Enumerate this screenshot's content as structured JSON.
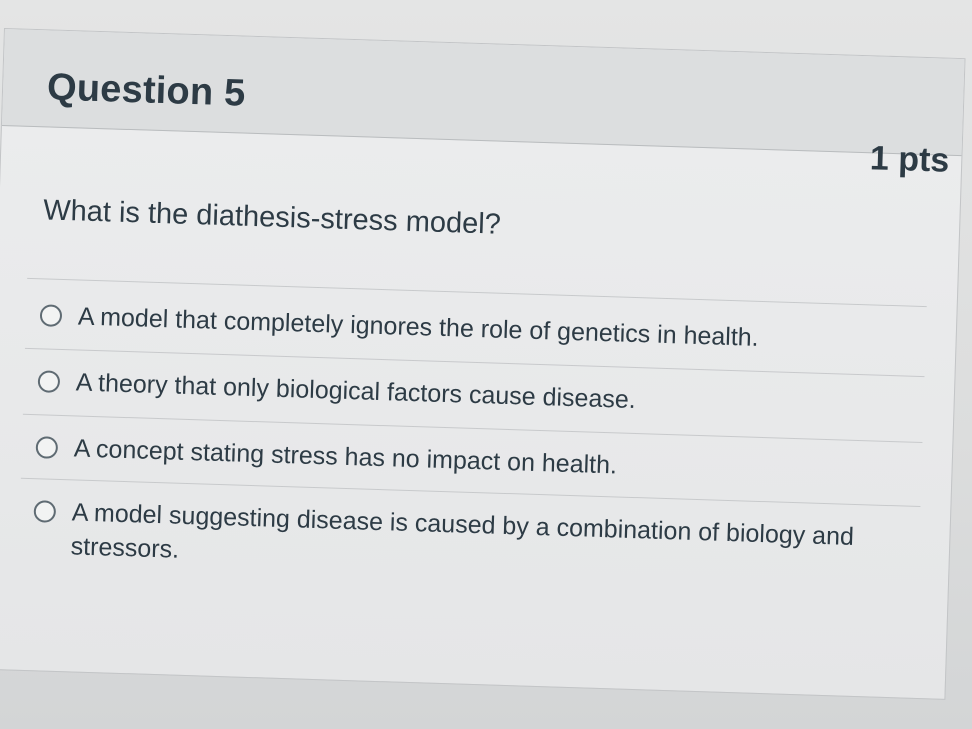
{
  "question": {
    "title": "Question 5",
    "points": "1 pts",
    "prompt": "What is the diathesis-stress model?"
  },
  "answers": [
    {
      "label": "A model that completely ignores the role of genetics in health."
    },
    {
      "label": "A theory that only biological factors cause disease."
    },
    {
      "label": "A concept stating stress has no impact on health."
    },
    {
      "label": "A model suggesting disease is caused by a combination of biology and stressors."
    }
  ]
}
